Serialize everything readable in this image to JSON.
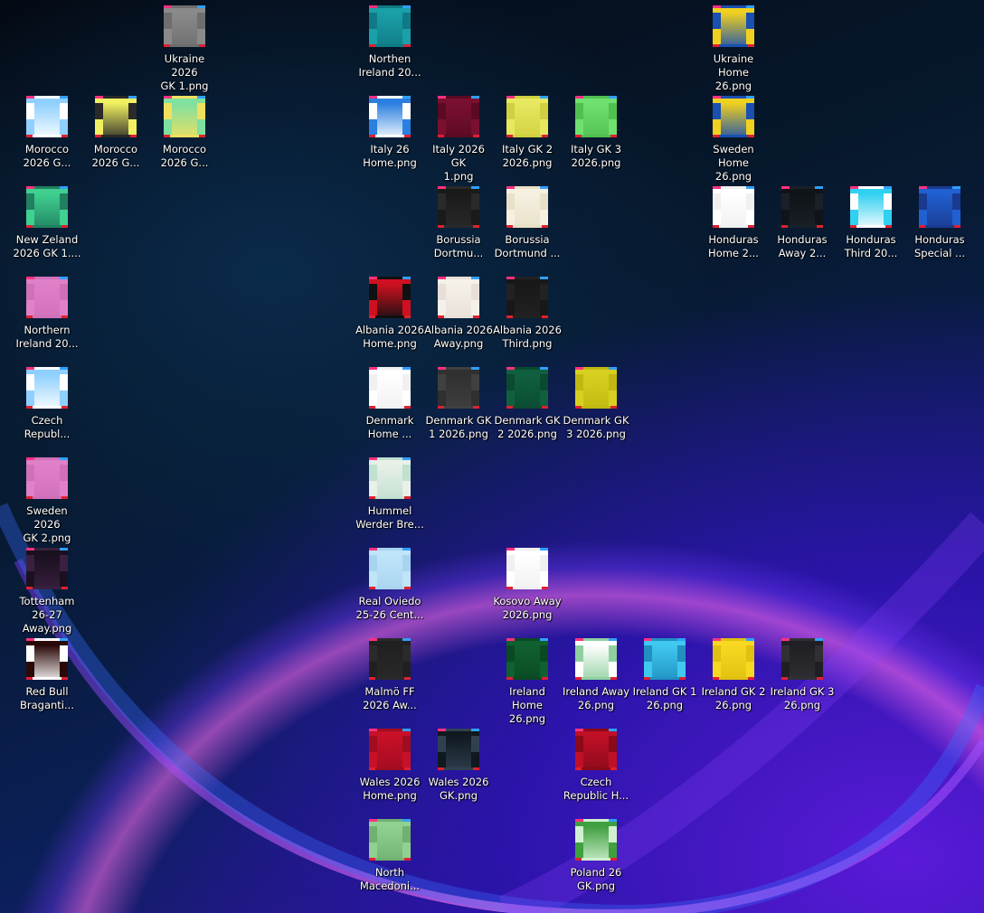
{
  "desktop": {
    "icons": [
      {
        "name": "ukraine-2026-gk-1",
        "lines": [
          "Ukraine 2026",
          "GK 1.png"
        ],
        "col": 2,
        "row": 0,
        "colors": [
          "#8a8a8a",
          "#6e6e6e"
        ]
      },
      {
        "name": "northen-ireland",
        "lines": [
          "Northen",
          "Ireland 20..."
        ],
        "col": 5,
        "row": 0,
        "colors": [
          "#1aa0a8",
          "#0f7a85"
        ]
      },
      {
        "name": "ukraine-home-26",
        "lines": [
          "Ukraine",
          "Home 26.png"
        ],
        "col": 10,
        "row": 0,
        "colors": [
          "#f0d020",
          "#1a50b0"
        ]
      },
      {
        "name": "morocco-2026-g-1",
        "lines": [
          "Morocco",
          "2026 G..."
        ],
        "col": 0,
        "row": 1,
        "colors": [
          "#8fd0ff",
          "#ffffff"
        ]
      },
      {
        "name": "morocco-2026-g-2",
        "lines": [
          "Morocco",
          "2026 G..."
        ],
        "col": 1,
        "row": 1,
        "colors": [
          "#f0f060",
          "#2a2a2a"
        ]
      },
      {
        "name": "morocco-2026-g-3",
        "lines": [
          "Morocco",
          "2026 G..."
        ],
        "col": 2,
        "row": 1,
        "colors": [
          "#7fe0a0",
          "#f0e060"
        ]
      },
      {
        "name": "italy-26-home",
        "lines": [
          "Italy 26",
          "Home.png"
        ],
        "col": 5,
        "row": 1,
        "colors": [
          "#2a7fe0",
          "#ffffff"
        ]
      },
      {
        "name": "italy-2026-gk-1",
        "lines": [
          "Italy 2026 GK",
          "1.png"
        ],
        "col": 6,
        "row": 1,
        "colors": [
          "#7a1030",
          "#5a0a22"
        ]
      },
      {
        "name": "italy-gk-2-2026",
        "lines": [
          "Italy GK 2",
          "2026.png"
        ],
        "col": 7,
        "row": 1,
        "colors": [
          "#e8e860",
          "#d0d040"
        ]
      },
      {
        "name": "italy-gk-3-2026",
        "lines": [
          "Italy GK 3",
          "2026.png"
        ],
        "col": 8,
        "row": 1,
        "colors": [
          "#70e070",
          "#50c050"
        ]
      },
      {
        "name": "sweden-home-26",
        "lines": [
          "Sweden",
          "Home 26.png"
        ],
        "col": 10,
        "row": 1,
        "colors": [
          "#f0d020",
          "#1a50b0"
        ]
      },
      {
        "name": "new-zeland-2026-gk-1",
        "lines": [
          "New Zeland",
          "2026 GK 1...."
        ],
        "col": 0,
        "row": 2,
        "colors": [
          "#40d090",
          "#208060"
        ]
      },
      {
        "name": "borussia-dortmund-1",
        "lines": [
          "Borussia",
          "Dortmu..."
        ],
        "col": 6,
        "row": 2,
        "colors": [
          "#1a1a1a",
          "#2a2a2a"
        ]
      },
      {
        "name": "borussia-dortmund-2",
        "lines": [
          "Borussia",
          "Dortmund ..."
        ],
        "col": 7,
        "row": 2,
        "colors": [
          "#f5f0e0",
          "#e8e0c8"
        ]
      },
      {
        "name": "honduras-home",
        "lines": [
          "Honduras",
          "Home 2..."
        ],
        "col": 10,
        "row": 2,
        "colors": [
          "#ffffff",
          "#f0f0f0"
        ]
      },
      {
        "name": "honduras-away",
        "lines": [
          "Honduras",
          "Away 2..."
        ],
        "col": 11,
        "row": 2,
        "colors": [
          "#101418",
          "#1a2028"
        ]
      },
      {
        "name": "honduras-third",
        "lines": [
          "Honduras",
          "Third 20..."
        ],
        "col": 12,
        "row": 2,
        "colors": [
          "#30d0f0",
          "#ffffff"
        ]
      },
      {
        "name": "honduras-special",
        "lines": [
          "Honduras",
          "Special ..."
        ],
        "col": 13,
        "row": 2,
        "colors": [
          "#2060d0",
          "#1a3a90"
        ]
      },
      {
        "name": "northern-ireland-20",
        "lines": [
          "Northern",
          "Ireland 20..."
        ],
        "col": 0,
        "row": 3,
        "colors": [
          "#e080c8",
          "#d070b8"
        ]
      },
      {
        "name": "albania-2026-home",
        "lines": [
          "Albania 2026",
          "Home.png"
        ],
        "col": 5,
        "row": 3,
        "colors": [
          "#d01020",
          "#101010"
        ]
      },
      {
        "name": "albania-2026-away",
        "lines": [
          "Albania 2026",
          "Away.png"
        ],
        "col": 6,
        "row": 3,
        "colors": [
          "#f5f0e8",
          "#e8e0d8"
        ]
      },
      {
        "name": "albania-2026-third",
        "lines": [
          "Albania 2026",
          "Third.png"
        ],
        "col": 7,
        "row": 3,
        "colors": [
          "#181818",
          "#222222"
        ]
      },
      {
        "name": "czech-republ",
        "lines": [
          "Czech",
          "Republ..."
        ],
        "col": 0,
        "row": 4,
        "colors": [
          "#8fd0ff",
          "#ffffff"
        ]
      },
      {
        "name": "denmark-home",
        "lines": [
          "Denmark",
          "Home ..."
        ],
        "col": 5,
        "row": 4,
        "colors": [
          "#ffffff",
          "#f0f0f0"
        ]
      },
      {
        "name": "denmark-gk-1-2026",
        "lines": [
          "Denmark GK",
          "1 2026.png"
        ],
        "col": 6,
        "row": 4,
        "colors": [
          "#303030",
          "#404040"
        ]
      },
      {
        "name": "denmark-gk-2-2026",
        "lines": [
          "Denmark GK",
          "2 2026.png"
        ],
        "col": 7,
        "row": 4,
        "colors": [
          "#106040",
          "#0a4a30"
        ]
      },
      {
        "name": "denmark-gk-3-2026",
        "lines": [
          "Denmark GK",
          "3 2026.png"
        ],
        "col": 8,
        "row": 4,
        "colors": [
          "#d8d020",
          "#c0b810"
        ]
      },
      {
        "name": "sweden-2026-gk-2",
        "lines": [
          "Sweden 2026",
          "GK 2.png"
        ],
        "col": 0,
        "row": 5,
        "colors": [
          "#e080c8",
          "#d070b8"
        ]
      },
      {
        "name": "hummel-werder-bremen",
        "lines": [
          "Hummel",
          "Werder Bre..."
        ],
        "col": 5,
        "row": 5,
        "colors": [
          "#e8f0e8",
          "#c0e0d0"
        ]
      },
      {
        "name": "tottenham-26-27-away",
        "lines": [
          "Tottenham",
          "26-27",
          "Away.png"
        ],
        "col": 0,
        "row": 6,
        "colors": [
          "#1a1020",
          "#3a2040"
        ]
      },
      {
        "name": "real-oviedo-25-26",
        "lines": [
          "Real Oviedo",
          "25-26 Cent..."
        ],
        "col": 5,
        "row": 6,
        "colors": [
          "#c0e4f8",
          "#a8d4f0"
        ]
      },
      {
        "name": "kosovo-away-2026",
        "lines": [
          "Kosovo Away",
          "2026.png"
        ],
        "col": 7,
        "row": 6,
        "colors": [
          "#ffffff",
          "#f0f0f0"
        ]
      },
      {
        "name": "red-bull-braganti",
        "lines": [
          "Red Bull",
          "Braganti..."
        ],
        "col": 0,
        "row": 7,
        "colors": [
          "#2a0a08",
          "#ffffff"
        ]
      },
      {
        "name": "malmo-ff-2026-away",
        "lines": [
          "Malmö FF",
          "2026 Aw..."
        ],
        "col": 5,
        "row": 7,
        "colors": [
          "#202020",
          "#2a2a2a"
        ]
      },
      {
        "name": "ireland-home-26",
        "lines": [
          "Ireland Home",
          "26.png"
        ],
        "col": 7,
        "row": 7,
        "colors": [
          "#106030",
          "#0a4a22"
        ]
      },
      {
        "name": "ireland-away-26",
        "lines": [
          "Ireland Away",
          "26.png"
        ],
        "col": 8,
        "row": 7,
        "colors": [
          "#ffffff",
          "#90d0a0"
        ]
      },
      {
        "name": "ireland-gk-1-26",
        "lines": [
          "Ireland GK 1",
          "26.png"
        ],
        "col": 9,
        "row": 7,
        "colors": [
          "#40c8f0",
          "#2090c0"
        ]
      },
      {
        "name": "ireland-gk-2-26",
        "lines": [
          "Ireland GK 2",
          "26.png"
        ],
        "col": 10,
        "row": 7,
        "colors": [
          "#f8d820",
          "#e0c010"
        ]
      },
      {
        "name": "ireland-gk-3-26",
        "lines": [
          "Ireland GK 3",
          "26.png"
        ],
        "col": 11,
        "row": 7,
        "colors": [
          "#202024",
          "#303034"
        ]
      },
      {
        "name": "wales-2026-home",
        "lines": [
          "Wales 2026",
          "Home.png"
        ],
        "col": 5,
        "row": 8,
        "colors": [
          "#c81028",
          "#a00c20"
        ]
      },
      {
        "name": "wales-2026-gk",
        "lines": [
          "Wales 2026",
          "GK.png"
        ],
        "col": 6,
        "row": 8,
        "colors": [
          "#101820",
          "#304050"
        ]
      },
      {
        "name": "czech-republic-h",
        "lines": [
          "Czech",
          "Republic H..."
        ],
        "col": 8,
        "row": 8,
        "colors": [
          "#c01028",
          "#8a0a1a"
        ]
      },
      {
        "name": "north-macedonia",
        "lines": [
          "North",
          "Macedoni..."
        ],
        "col": 5,
        "row": 9,
        "colors": [
          "#90d090",
          "#70b070"
        ]
      },
      {
        "name": "poland-26-gk",
        "lines": [
          "Poland 26",
          "GK.png"
        ],
        "col": 8,
        "row": 9,
        "colors": [
          "#40a040",
          "#d0f0d0"
        ]
      }
    ]
  }
}
